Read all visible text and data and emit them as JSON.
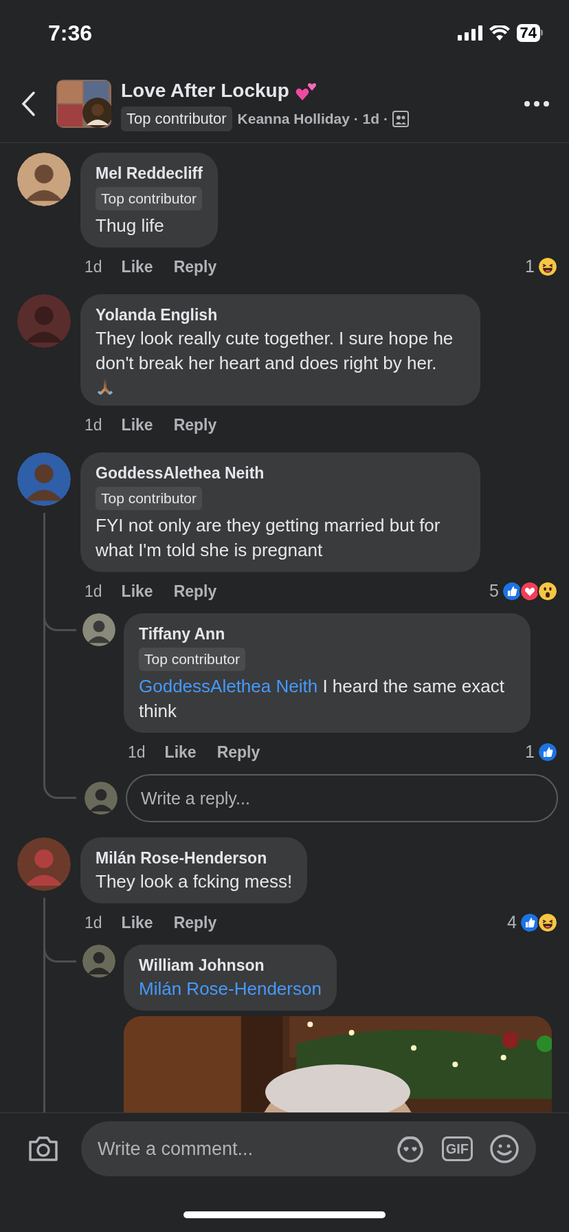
{
  "status_bar": {
    "time": "7:36",
    "battery": "74"
  },
  "header": {
    "title": "Love After Lockup",
    "badge": "Top contributor",
    "meta": "Keanna Holliday · 1d ·"
  },
  "comments": [
    {
      "author": "Mel Reddecliff",
      "badge": "Top contributor",
      "text": "Thug life",
      "time": "1d",
      "like": "Like",
      "reply": "Reply",
      "reaction_count": "1",
      "reactions": [
        {
          "kind": "haha"
        }
      ]
    },
    {
      "author": "Yolanda English",
      "text": "They look really cute together. I sure hope he don't break her heart and does right by her.",
      "emoji_line": true,
      "time": "1d",
      "like": "Like",
      "reply": "Reply"
    },
    {
      "author": "GoddessAlethea Neith",
      "badge": "Top contributor",
      "text": "FYI not only are they getting married but for what I'm told she is pregnant",
      "time": "1d",
      "like": "Like",
      "reply": "Reply",
      "reaction_count": "5",
      "reactions": [
        {
          "kind": "like"
        },
        {
          "kind": "love"
        },
        {
          "kind": "wow"
        }
      ],
      "replies": [
        {
          "author": "Tiffany Ann",
          "badge": "Top contributor",
          "mention": "GoddessAlethea Neith",
          "text": "I heard the same exact think",
          "time": "1d",
          "like": "Like",
          "reply": "Reply",
          "reaction_count": "1",
          "reactions": [
            {
              "kind": "like"
            }
          ]
        }
      ],
      "reply_field": {
        "placeholder": "Write a reply..."
      }
    },
    {
      "author": "Milán Rose-Henderson",
      "text": "They look a fcking mess!",
      "time": "1d",
      "like": "Like",
      "reply": "Reply",
      "reaction_count": "4",
      "reactions": [
        {
          "kind": "like"
        },
        {
          "kind": "haha"
        }
      ],
      "replies": [
        {
          "author": "William Johnson",
          "mention": "Milán Rose-Henderson"
        }
      ]
    }
  ],
  "composer": {
    "placeholder": "Write a comment...",
    "gif_label": "GIF"
  }
}
